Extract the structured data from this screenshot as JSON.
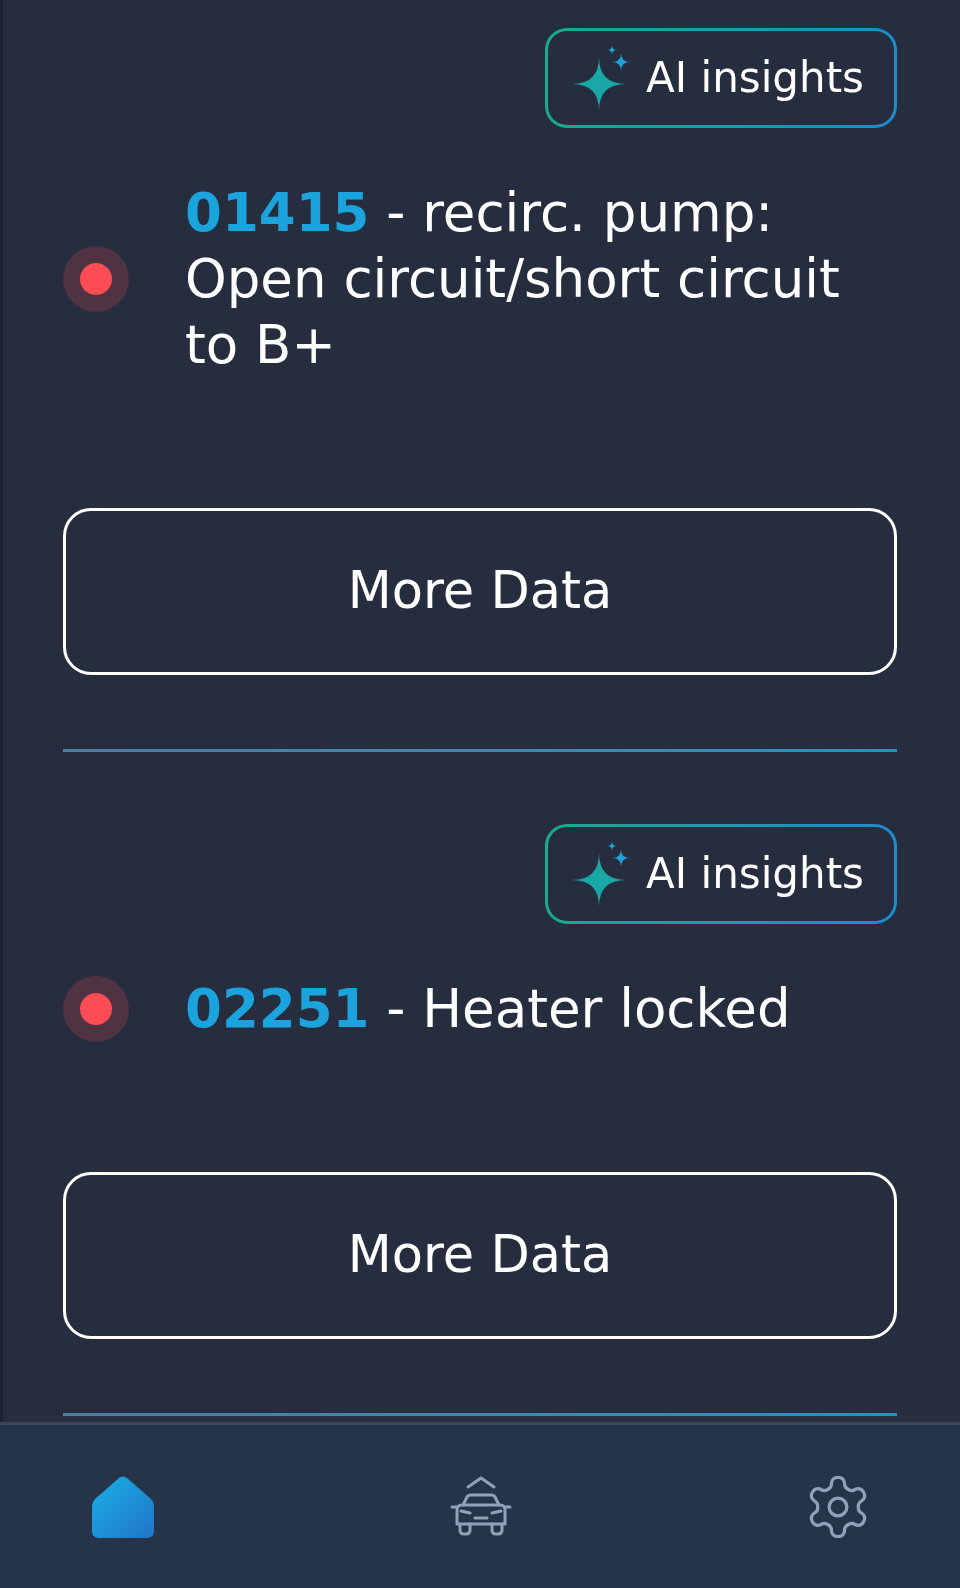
{
  "faults": [
    {
      "insights_button": "AI insights",
      "color": "#ff4d55",
      "text": "**01415** - recirc. pump: Open circuit/short circuit to B+",
      "more_button": "More Data"
    },
    {
      "insights_button": "AI insights",
      "color": "#ff4d55",
      "text": "**02251** - Heater locked",
      "more_button": "More Data"
    }
  ],
  "nav": [
    {
      "kind": "home",
      "selected": true
    },
    {
      "kind": "vehicle",
      "selected": false
    },
    {
      "kind": "settings",
      "selected": false
    }
  ]
}
